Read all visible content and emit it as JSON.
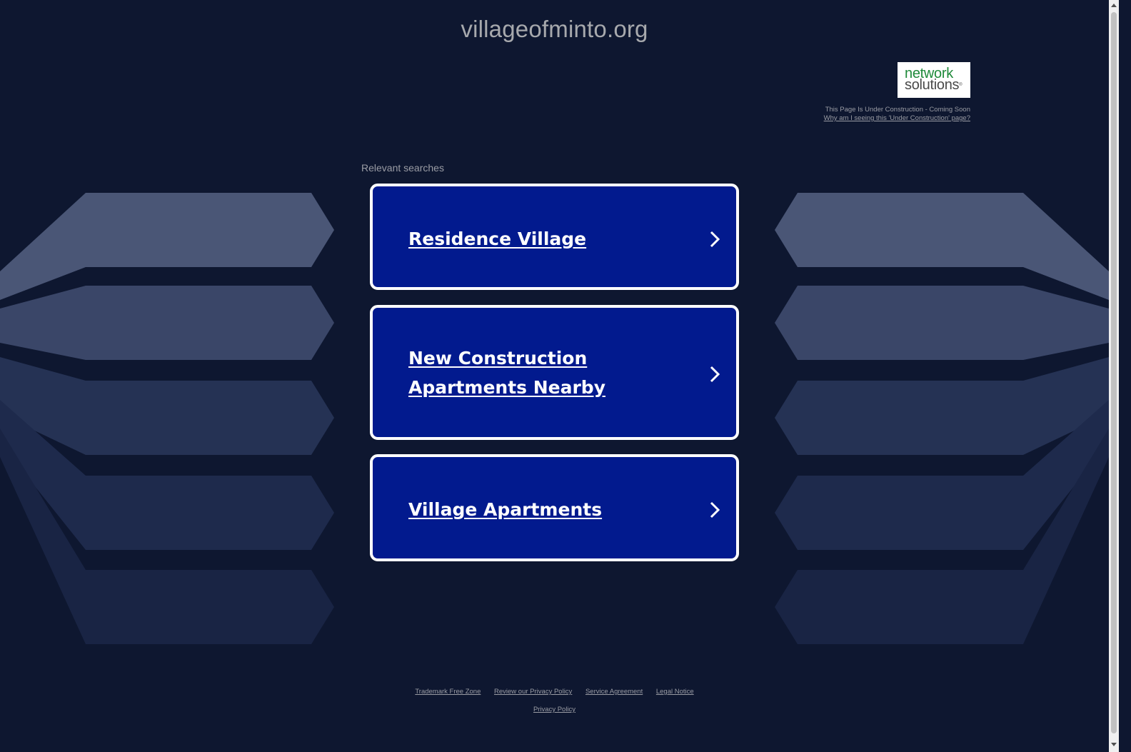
{
  "header": {
    "domain": "villageofminto.org"
  },
  "logo": {
    "line1": "network",
    "line2": "solutions",
    "mark": "®"
  },
  "notice": {
    "status": "This Page Is Under Construction - Coming Soon",
    "why_link": "Why am I seeing this 'Under Construction' page?"
  },
  "searches": {
    "heading": "Relevant searches",
    "items": [
      {
        "label": "Residence Village"
      },
      {
        "label": "New Construction Apartments Nearby"
      },
      {
        "label": "Village Apartments"
      }
    ]
  },
  "footer": {
    "links": [
      "Trademark Free Zone",
      "Review our Privacy Policy",
      "Service Agreement",
      "Legal Notice"
    ],
    "privacy": "Privacy Policy"
  },
  "colors": {
    "background": "#0e1730",
    "card": "#021a8e",
    "card_border": "#ffffff"
  },
  "icons": {
    "card_arrow": "chevron-right-icon"
  }
}
